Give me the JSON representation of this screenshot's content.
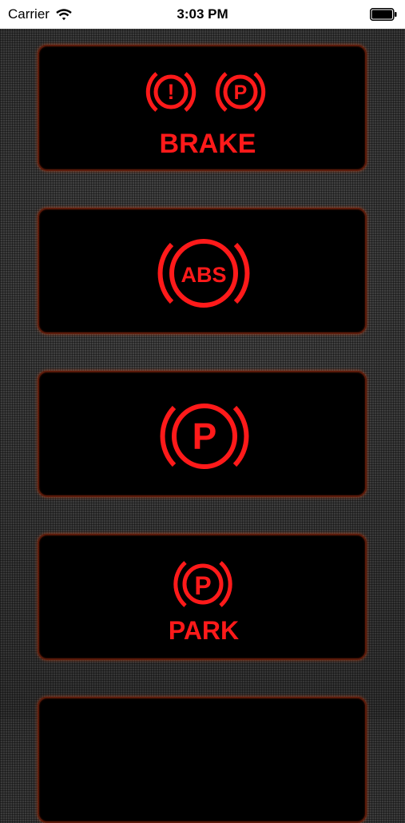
{
  "status_bar": {
    "carrier": "Carrier",
    "time": "3:03 PM"
  },
  "colors": {
    "warning_red": "#ff1a1a",
    "card_border": "#5a1a0a",
    "background": "#3a3a3a"
  },
  "lights": [
    {
      "icons": [
        "brake-warning-icon",
        "parking-brake-icon"
      ],
      "label": "BRAKE"
    },
    {
      "icons": [
        "abs-icon"
      ],
      "icon_text": "ABS",
      "label": ""
    },
    {
      "icons": [
        "parking-brake-icon"
      ],
      "icon_text": "P",
      "label": ""
    },
    {
      "icons": [
        "parking-brake-icon"
      ],
      "icon_text": "P",
      "label": "PARK"
    },
    {
      "icons": [],
      "label": ""
    }
  ],
  "brake_icons": {
    "exclaim": "!",
    "p": "P"
  }
}
